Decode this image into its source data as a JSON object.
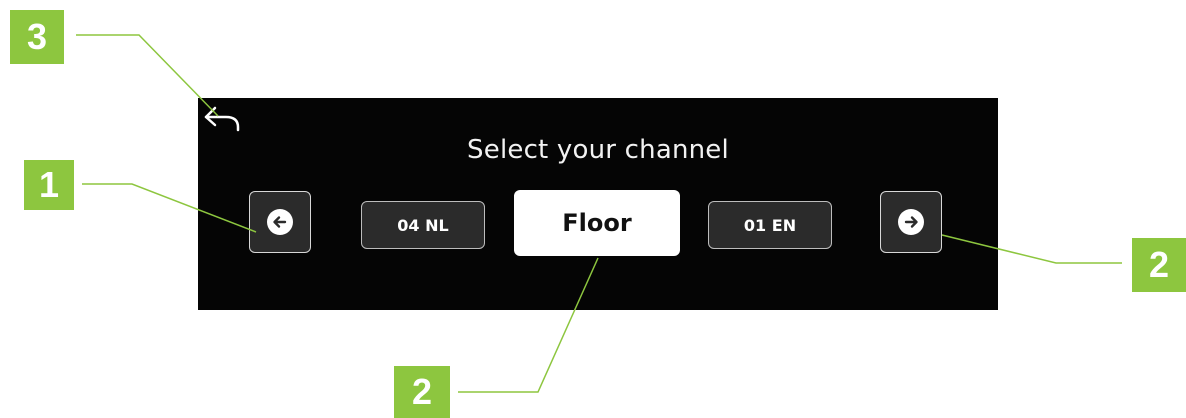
{
  "screen": {
    "title": "Select your channel",
    "back_icon": "back-arrow-icon",
    "prev_icon": "arrow-left-icon",
    "next_icon": "arrow-right-icon",
    "channels": {
      "previous": "04 NL",
      "current": "Floor",
      "next": "01 EN"
    }
  },
  "callouts": {
    "back": "3",
    "prev": "1",
    "next": "2",
    "current": "2"
  },
  "colors": {
    "callout_green": "#8dc63f",
    "screen_background": "#050505",
    "button_background": "#2b2b2b",
    "selected_background": "#ffffff"
  }
}
